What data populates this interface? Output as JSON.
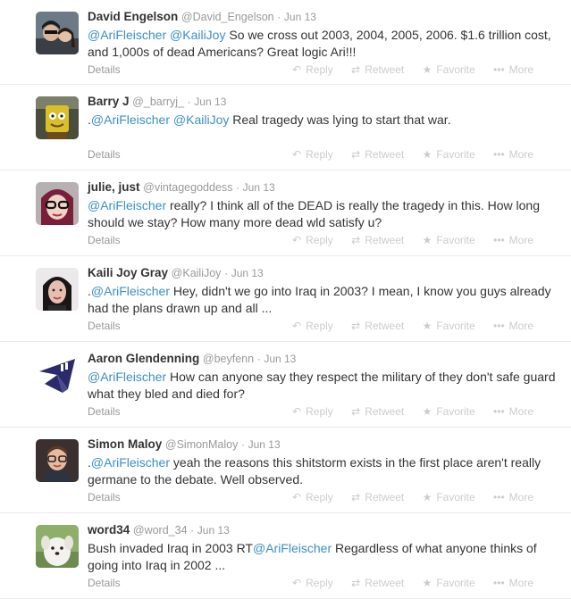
{
  "actions": {
    "reply_label": "Reply",
    "retweet_label": "Retweet",
    "favorite_label": "Favorite",
    "more_label": "More",
    "details_label": "Details"
  },
  "tweets": [
    {
      "fullname": "David Engelson",
      "username": "@David_Engelson",
      "time": "Jun 13",
      "lead": "",
      "mention1": "@AriFleischer",
      "mid": " ",
      "mention2": "@KailiJoy",
      "body": " So we cross out 2003, 2004, 2005, 2006. $1.6 trillion cost, and 1,000s of dead Americans? Great logic Ari!!!",
      "avatar_icon": "avatar-couple-photo"
    },
    {
      "fullname": "Barry J",
      "username": "@_barryj_",
      "time": "Jun 13",
      "lead": ".",
      "mention1": "@AriFleischer",
      "mid": " ",
      "mention2": "@KailiJoy",
      "body": " Real tragedy was lying to start that war.",
      "avatar_icon": "avatar-yellow-figure"
    },
    {
      "fullname": "julie, just",
      "username": "@vintagegoddess",
      "time": "Jun 13",
      "lead": "",
      "mention1": "@AriFleischer",
      "mid": "",
      "mention2": "",
      "body": " really? I think all of the DEAD is really the tragedy in this. How long should we stay? How many more dead wld satisfy u?",
      "avatar_icon": "avatar-woman-glasses"
    },
    {
      "fullname": "Kaili Joy Gray",
      "username": "@KailiJoy",
      "time": "Jun 13",
      "lead": ".",
      "mention1": "@AriFleischer",
      "mid": "",
      "mention2": "",
      "body": " Hey, didn't we go into Iraq in 2003? I mean, I know you guys already had the plans drawn up and all ...",
      "avatar_icon": "avatar-woman-dark-hair"
    },
    {
      "fullname": "Aaron Glendenning",
      "username": "@beyfenn",
      "time": "Jun 13",
      "lead": "",
      "mention1": "@AriFleischer",
      "mid": "",
      "mention2": "",
      "body": " How can anyone say they respect the military of they don't safe guard what they bled and died for?",
      "avatar_icon": "avatar-geometric-logo"
    },
    {
      "fullname": "Simon Maloy",
      "username": "@SimonMaloy",
      "time": "Jun 13",
      "lead": ".",
      "mention1": "@AriFleischer",
      "mid": "",
      "mention2": "",
      "body": " yeah the reasons this shitstorm exists in the first place aren't really germane to the debate. Well observed.",
      "avatar_icon": "avatar-man-glasses"
    },
    {
      "fullname": "word34",
      "username": "@word_34",
      "time": "Jun 13",
      "lead": "Bush invaded Iraq in 2003  RT",
      "mention1": "@AriFleischer",
      "mid": "",
      "mention2": "",
      "body": " Regardless of what anyone thinks of going into Iraq in 2002 ...",
      "avatar_icon": "avatar-white-dog"
    }
  ],
  "colors": {
    "mention": "#3b8fc3",
    "meta": "#999999",
    "action": "#cccccc",
    "divider": "#e8e8e8"
  }
}
